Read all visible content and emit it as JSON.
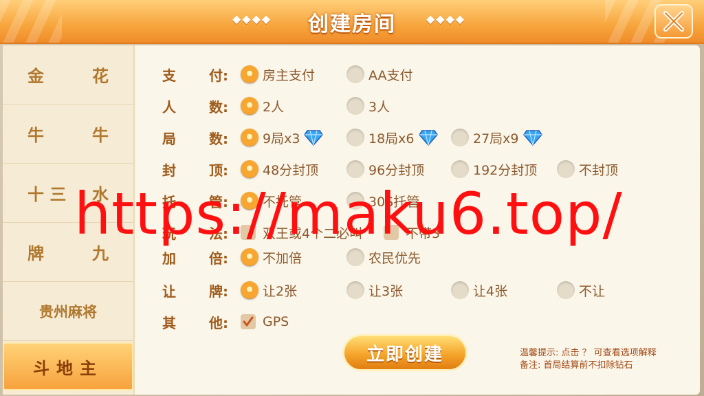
{
  "header": {
    "title": "创建房间",
    "deco_left": "◆◆◆◆",
    "deco_right": "◆◆◆◆"
  },
  "sidebar": {
    "items": [
      {
        "left": "金",
        "right": "花"
      },
      {
        "left": "牛",
        "right": "牛"
      },
      {
        "left": "十 三",
        "right": "水"
      },
      {
        "left": "牌",
        "right": "九"
      },
      {
        "label": "贵州麻将"
      },
      {
        "label": "斗地主"
      }
    ]
  },
  "rows": {
    "pay": {
      "label": [
        "支",
        "付:"
      ],
      "options": [
        "房主支付",
        "AA支付"
      ]
    },
    "players": {
      "label": [
        "人",
        "数:"
      ],
      "options": [
        "2人",
        "3人"
      ]
    },
    "rounds": {
      "label": [
        "局",
        "数:"
      ],
      "options": [
        "9局x3",
        "18局x6",
        "27局x9"
      ]
    },
    "cap": {
      "label": [
        "封",
        "顶:"
      ],
      "options": [
        "48分封顶",
        "96分封顶",
        "192分封顶",
        "不封顶"
      ]
    },
    "auto": {
      "label": [
        "托",
        "管:"
      ],
      "options": [
        "不托管",
        "30S托管"
      ]
    },
    "play": {
      "label": [
        "玩",
        "法:"
      ],
      "options": [
        "双王或4个二必叫",
        "不带3"
      ]
    },
    "double": {
      "label": [
        "加",
        "倍:"
      ],
      "options": [
        "不加倍",
        "农民优先"
      ]
    },
    "yield": {
      "label": [
        "让",
        "牌:"
      ],
      "options": [
        "让2张",
        "让3张",
        "让4张",
        "不让"
      ]
    },
    "other": {
      "label": [
        "其",
        "他:"
      ],
      "options": [
        "GPS"
      ]
    }
  },
  "create_button": "立即创建",
  "hints": {
    "line1": "温馨提示: 点击 ？ 可查看选项解释",
    "line2": "备注: 首局结算前不扣除钻石"
  },
  "watermark": "https://maku6.top/",
  "colors": {
    "accent": "#f7a23d",
    "label": "#9e5b1c",
    "option": "#8b5a2e"
  }
}
